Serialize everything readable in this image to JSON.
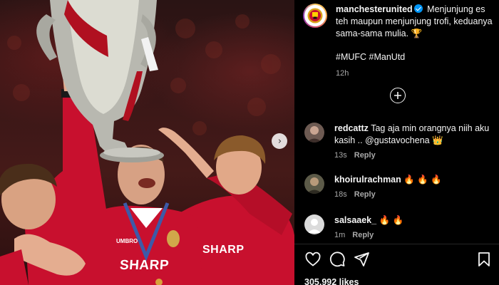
{
  "post": {
    "username": "manchesterunited",
    "caption": "Menjunjung es teh maupun menjunjung trofi, keduanya sama-sama mulia. 🏆",
    "hashtags": "#MUFC #ManUtd",
    "time": "12h",
    "likes": "305,992 likes"
  },
  "photo": {
    "shirt_text": "SHARP",
    "shirt_text_2": "SHARP",
    "umbro": "UMBRO"
  },
  "comments": [
    {
      "username": "redcattz",
      "text": "Tag aja min orangnya niih aku kasih .. @gustavochena 👑",
      "time": "13s",
      "reply": "Reply"
    },
    {
      "username": "khoirulrachman",
      "text": "🔥 🔥 🔥",
      "time": "18s",
      "reply": "Reply"
    },
    {
      "username": "salsaaek_",
      "text": "🔥 🔥",
      "time": "1m",
      "reply": "Reply"
    }
  ],
  "icons": {
    "like": "heart-icon",
    "comment": "comment-icon",
    "share": "share-icon",
    "save": "bookmark-icon",
    "load_more": "plus-circle-icon",
    "next": "chevron-right-icon"
  },
  "colors": {
    "background": "#000000",
    "text": "#f5f5f5",
    "muted": "#a8a8a8",
    "verified": "#0095f6",
    "shirt_red": "#c8102e"
  }
}
